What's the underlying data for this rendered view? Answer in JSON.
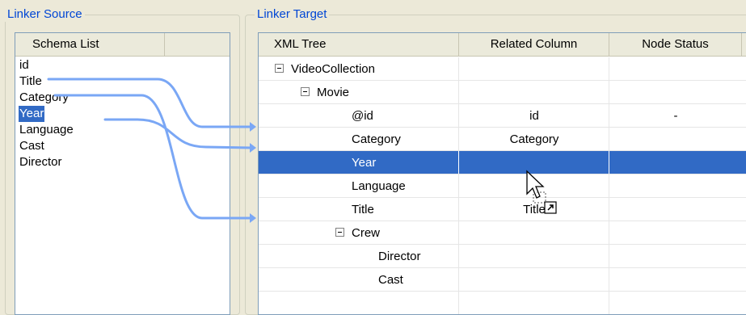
{
  "source": {
    "title": "Linker Source",
    "column_header": "Schema List",
    "items": [
      "id",
      "Title",
      "Category",
      "Year",
      "Language",
      "Cast",
      "Director"
    ],
    "selected": "Year"
  },
  "target": {
    "title": "Linker Target",
    "headers": [
      "XML Tree",
      "Related Column",
      "Node Status"
    ],
    "rows": [
      {
        "node": "VideoCollection",
        "related": "",
        "status": "",
        "expandable": true
      },
      {
        "node": "Movie",
        "related": "",
        "status": "",
        "expandable": true
      },
      {
        "node": "@id",
        "related": "id",
        "status": "-",
        "expandable": false
      },
      {
        "node": "Category",
        "related": "Category",
        "status": "",
        "expandable": false
      },
      {
        "node": "Year",
        "related": "",
        "status": "",
        "expandable": false,
        "selected": true
      },
      {
        "node": "Language",
        "related": "",
        "status": "",
        "expandable": false
      },
      {
        "node": "Title",
        "related": "Title",
        "status": "",
        "expandable": false
      },
      {
        "node": "Crew",
        "related": "",
        "status": "",
        "expandable": true
      },
      {
        "node": "Director",
        "related": "",
        "status": "",
        "expandable": false
      },
      {
        "node": "Cast",
        "related": "",
        "status": "",
        "expandable": false
      }
    ]
  },
  "colors": {
    "link_line": "#7aa7f5",
    "selection": "#316ac5",
    "group_title": "#0046d5"
  },
  "icons": [
    "expander-minus-icon",
    "drag-cursor-icon"
  ]
}
